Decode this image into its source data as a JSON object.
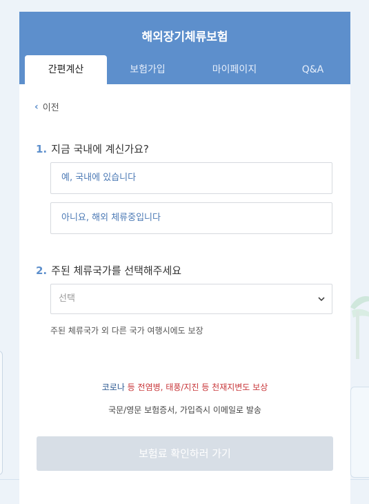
{
  "header": {
    "title": "해외장기체류보험"
  },
  "tabs": [
    {
      "label": "간편계산",
      "active": true
    },
    {
      "label": "보험가입"
    },
    {
      "label": "마이페이지"
    },
    {
      "label": "Q&A"
    }
  ],
  "back": {
    "label": "이전"
  },
  "question1": {
    "number": "1.",
    "text": "지금 국내에 계신가요?",
    "options": [
      "예, 국내에 있습니다",
      "아니요, 해외 체류중입니다"
    ]
  },
  "question2": {
    "number": "2.",
    "text": "주된 체류국가를 선택해주세요",
    "select_value": "선택",
    "note": "주된 체류국가 외 다른 국가 여행시에도 보장"
  },
  "promo": {
    "line1_highlight": "코로나",
    "line1_rest": " 등 전염병, 태풍/지진 등 천재지변도 보상",
    "line2": "국문/영문 보험증서, 가입즉시 이메일로 발송"
  },
  "cta": {
    "label": "보험료 확인하러 가기"
  },
  "colors": {
    "primary": "#5d8fcc",
    "accent_red": "#c8373a",
    "cta_disabled": "#d7dee6"
  }
}
